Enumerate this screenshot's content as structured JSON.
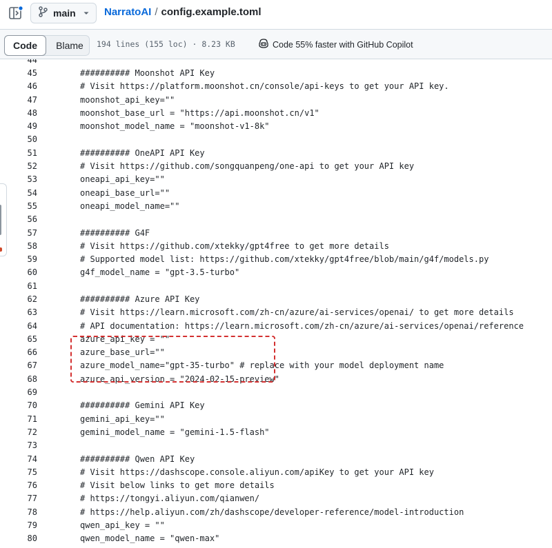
{
  "header": {
    "branch": "main",
    "repo": "NarratoAI",
    "separator": "/",
    "file": "config.example.toml"
  },
  "toolbar": {
    "tab_code": "Code",
    "tab_blame": "Blame",
    "file_meta": "194 lines (155 loc) · 8.23 KB",
    "copilot": "Code 55% faster with GitHub Copilot"
  },
  "code_lines": [
    {
      "n": "44",
      "t": ""
    },
    {
      "n": "45",
      "t": "########## Moonshot API Key"
    },
    {
      "n": "46",
      "t": "# Visit https://platform.moonshot.cn/console/api-keys to get your API key."
    },
    {
      "n": "47",
      "t": "moonshot_api_key=\"\""
    },
    {
      "n": "48",
      "t": "moonshot_base_url = \"https://api.moonshot.cn/v1\""
    },
    {
      "n": "49",
      "t": "moonshot_model_name = \"moonshot-v1-8k\""
    },
    {
      "n": "50",
      "t": ""
    },
    {
      "n": "51",
      "t": "########## OneAPI API Key"
    },
    {
      "n": "52",
      "t": "# Visit https://github.com/songquanpeng/one-api to get your API key"
    },
    {
      "n": "53",
      "t": "oneapi_api_key=\"\""
    },
    {
      "n": "54",
      "t": "oneapi_base_url=\"\""
    },
    {
      "n": "55",
      "t": "oneapi_model_name=\"\""
    },
    {
      "n": "56",
      "t": ""
    },
    {
      "n": "57",
      "t": "########## G4F"
    },
    {
      "n": "58",
      "t": "# Visit https://github.com/xtekky/gpt4free to get more details"
    },
    {
      "n": "59",
      "t": "# Supported model list: https://github.com/xtekky/gpt4free/blob/main/g4f/models.py"
    },
    {
      "n": "60",
      "t": "g4f_model_name = \"gpt-3.5-turbo\""
    },
    {
      "n": "61",
      "t": ""
    },
    {
      "n": "62",
      "t": "########## Azure API Key"
    },
    {
      "n": "63",
      "t": "# Visit https://learn.microsoft.com/zh-cn/azure/ai-services/openai/ to get more details"
    },
    {
      "n": "64",
      "t": "# API documentation: https://learn.microsoft.com/zh-cn/azure/ai-services/openai/reference"
    },
    {
      "n": "65",
      "t": "azure_api_key = \"\""
    },
    {
      "n": "66",
      "t": "azure_base_url=\"\""
    },
    {
      "n": "67",
      "t": "azure_model_name=\"gpt-35-turbo\" # replace with your model deployment name"
    },
    {
      "n": "68",
      "t": "azure_api_version = \"2024-02-15-preview\""
    },
    {
      "n": "69",
      "t": ""
    },
    {
      "n": "70",
      "t": "########## Gemini API Key"
    },
    {
      "n": "71",
      "t": "gemini_api_key=\"\""
    },
    {
      "n": "72",
      "t": "gemini_model_name = \"gemini-1.5-flash\""
    },
    {
      "n": "73",
      "t": ""
    },
    {
      "n": "74",
      "t": "########## Qwen API Key"
    },
    {
      "n": "75",
      "t": "# Visit https://dashscope.console.aliyun.com/apiKey to get your API key"
    },
    {
      "n": "76",
      "t": "# Visit below links to get more details"
    },
    {
      "n": "77",
      "t": "# https://tongyi.aliyun.com/qianwen/"
    },
    {
      "n": "78",
      "t": "# https://help.aliyun.com/zh/dashscope/developer-reference/model-introduction"
    },
    {
      "n": "79",
      "t": "qwen_api_key = \"\""
    },
    {
      "n": "80",
      "t": "qwen_model_name = \"qwen-max\""
    }
  ],
  "icons": {
    "panel_toggle": "sidebar-expand-icon",
    "branch": "git-branch-icon",
    "caret": "triangle-down-icon",
    "copilot": "copilot-icon"
  },
  "colors": {
    "link": "#0969da",
    "highlight_border": "#d32f2f",
    "notification_dot": "#0969da"
  }
}
